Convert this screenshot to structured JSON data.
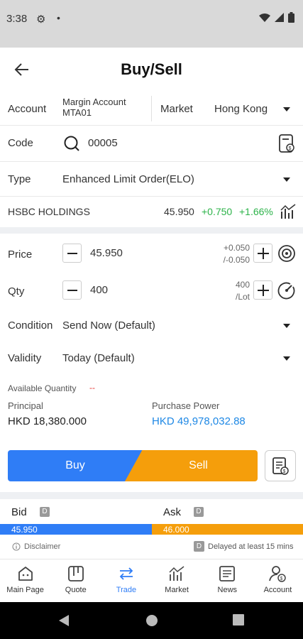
{
  "status_bar": {
    "time": "3:38"
  },
  "header": {
    "title": "Buy/Sell"
  },
  "account": {
    "label": "Account",
    "line1": "Margin Account",
    "line2": "MTA01",
    "market_label": "Market",
    "market_value": "Hong Kong"
  },
  "code": {
    "label": "Code",
    "value": "00005"
  },
  "type": {
    "label": "Type",
    "value": "Enhanced Limit Order(ELO)"
  },
  "quote": {
    "name": "HSBC HOLDINGS",
    "price": "45.950",
    "change": "+0.750",
    "change_pct": "+1.66%"
  },
  "price": {
    "label": "Price",
    "value": "45.950",
    "step_up": "+0.050",
    "step_down": "/-0.050"
  },
  "qty": {
    "label": "Qty",
    "value": "400",
    "lot_top": "400",
    "lot_bottom": "/Lot"
  },
  "condition": {
    "label": "Condition",
    "value": "Send Now (Default)"
  },
  "validity": {
    "label": "Validity",
    "value": "Today (Default)"
  },
  "available": {
    "label": "Available Quantity",
    "value": "--"
  },
  "principal": {
    "label": "Principal",
    "value": "HKD 18,380.000"
  },
  "purchase_power": {
    "label": "Purchase Power",
    "value": "HKD 49,978,032.88"
  },
  "actions": {
    "buy": "Buy",
    "sell": "Sell"
  },
  "depth": {
    "bid_label": "Bid",
    "ask_label": "Ask",
    "badge": "D",
    "bid_price": "45.950",
    "ask_price": "46.000",
    "bid_fraction": 0.5,
    "disclaimer": "Disclaimer",
    "delay_note": "Delayed at least 15 mins"
  },
  "tabs": [
    {
      "label": "Main Page",
      "icon": "home-icon"
    },
    {
      "label": "Quote",
      "icon": "quote-icon"
    },
    {
      "label": "Trade",
      "icon": "trade-icon"
    },
    {
      "label": "Market",
      "icon": "market-icon"
    },
    {
      "label": "News",
      "icon": "news-icon"
    },
    {
      "label": "Account",
      "icon": "account-icon"
    }
  ],
  "colors": {
    "buy": "#2f7df6",
    "sell": "#f59e0b",
    "up": "#2db34a",
    "link": "#1e88e5"
  }
}
